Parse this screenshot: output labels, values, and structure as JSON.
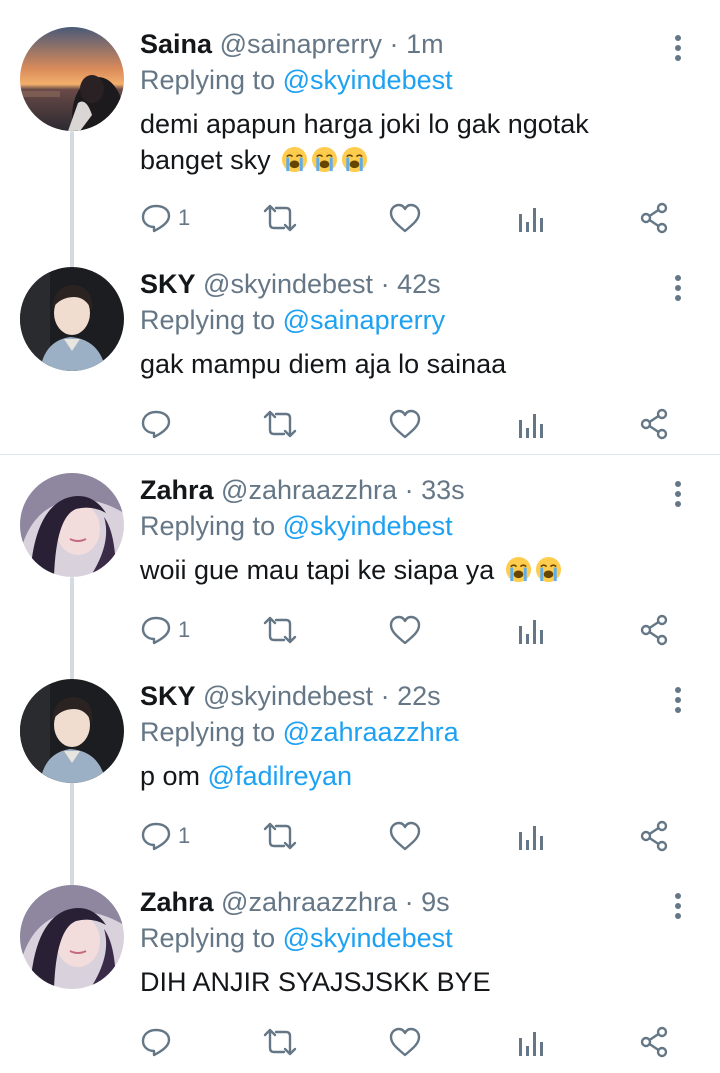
{
  "icons": {
    "reply": "reply-bubble-icon",
    "retweet": "retweet-icon",
    "like": "heart-icon",
    "analytics": "analytics-bars-icon",
    "share": "share-icon",
    "more": "vertical-ellipsis-icon",
    "emoji": "loudly-crying-face-emoji"
  },
  "colors": {
    "text": "#14171a",
    "secondary": "#657786",
    "link": "#1da1f2",
    "divider": "#e1e8ed",
    "thread_line": "#d3dbe1"
  },
  "replying_prefix": "Replying to",
  "tweets": [
    {
      "name": "Saina",
      "handle": "@sainaprerry",
      "dot": "·",
      "time": "1m",
      "replying_to": "@skyindebest",
      "text": "demi apapun harga joki lo gak ngotak banget sky",
      "emoji_count": 3,
      "reply_count": "1"
    },
    {
      "name": "SKY",
      "handle": "@skyindebest",
      "dot": "·",
      "time": "42s",
      "replying_to": "@sainaprerry",
      "text": "gak mampu diem aja lo sainaa",
      "emoji_count": 0,
      "reply_count": ""
    },
    {
      "name": "Zahra",
      "handle": "@zahraazzhra",
      "dot": "·",
      "time": "33s",
      "replying_to": "@skyindebest",
      "text": "woii gue mau tapi ke siapa ya",
      "emoji_count": 2,
      "reply_count": "1"
    },
    {
      "name": "SKY",
      "handle": "@skyindebest",
      "dot": "·",
      "time": "22s",
      "replying_to": "@zahraazzhra",
      "text": "p om",
      "mention": "@fadilreyan",
      "emoji_count": 0,
      "reply_count": "1"
    },
    {
      "name": "Zahra",
      "handle": "@zahraazzhra",
      "dot": "·",
      "time": "9s",
      "replying_to": "@skyindebest",
      "text": "DIH ANJIR SYAJSJSKK BYE",
      "emoji_count": 0,
      "reply_count": ""
    }
  ]
}
